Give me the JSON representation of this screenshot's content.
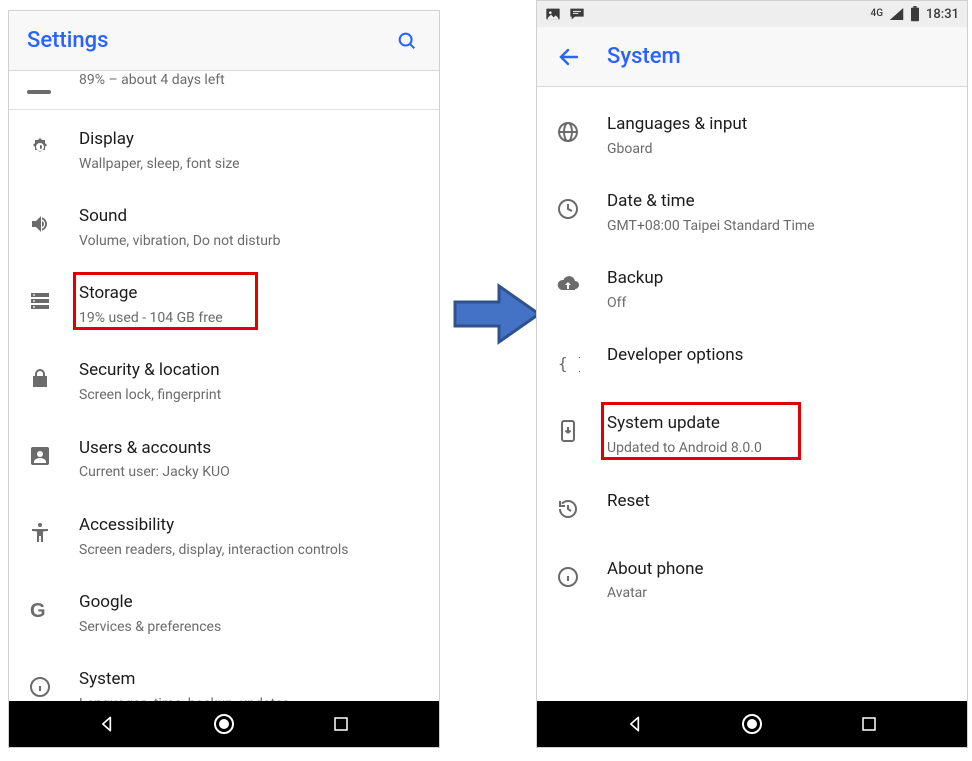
{
  "left": {
    "header_title": "Settings",
    "cut_sub": "89% – about 4 days left",
    "items": [
      {
        "label": "Display",
        "sub": "Wallpaper, sleep, font size"
      },
      {
        "label": "Sound",
        "sub": "Volume, vibration, Do not disturb"
      },
      {
        "label": "Storage",
        "sub": "19% used - 104 GB free"
      },
      {
        "label": "Security & location",
        "sub": "Screen lock, fingerprint"
      },
      {
        "label": "Users & accounts",
        "sub": "Current user: Jacky KUO"
      },
      {
        "label": "Accessibility",
        "sub": "Screen readers, display, interaction controls"
      },
      {
        "label": "Google",
        "sub": "Services & preferences"
      },
      {
        "label": "System",
        "sub": "Languages, time, backup, updates"
      }
    ]
  },
  "right": {
    "status": {
      "net": "4G",
      "time": "18:31"
    },
    "header_title": "System",
    "items": [
      {
        "label": "Languages & input",
        "sub": "Gboard"
      },
      {
        "label": "Date & time",
        "sub": "GMT+08:00 Taipei Standard Time"
      },
      {
        "label": "Backup",
        "sub": "Off"
      },
      {
        "label": "Developer options",
        "sub": ""
      },
      {
        "label": "System update",
        "sub": "Updated to Android 8.0.0"
      },
      {
        "label": "Reset",
        "sub": ""
      },
      {
        "label": "About phone",
        "sub": "Avatar"
      }
    ]
  },
  "highlights": {
    "left_index": 2,
    "right_index": 4
  },
  "colors": {
    "accent": "#2962ff",
    "highlight": "#e00000",
    "arrow_fill": "#4472c4",
    "arrow_stroke": "#2f528f"
  }
}
